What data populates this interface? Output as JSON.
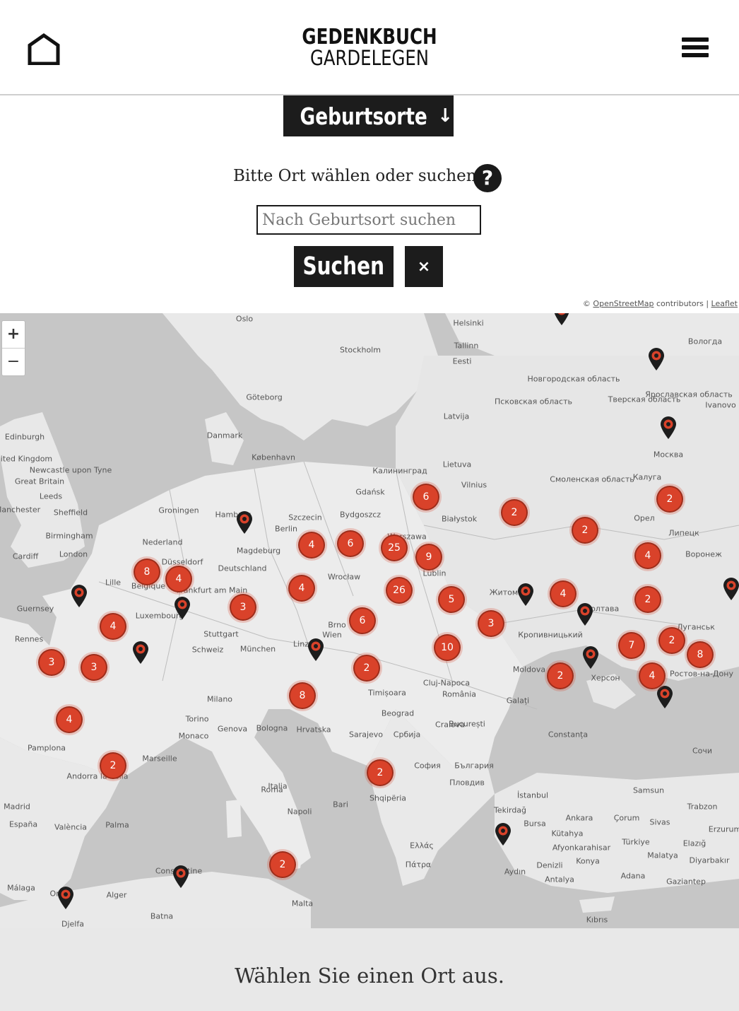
{
  "header": {
    "logo_line1": "GEDENKBUCH",
    "logo_line2": "GARDELEGEN",
    "home_icon": "home-icon",
    "menu_icon": "hamburger-menu-icon"
  },
  "filter": {
    "dropdown_label": "Geburtsorte",
    "dropdown_icon": "arrow-down-icon"
  },
  "instruction": "Bitte Ort wählen oder suchen.",
  "help_glyph": "?",
  "search": {
    "placeholder": "Nach Geburtsort suchen",
    "value": "",
    "button_label": "Suchen",
    "clear_label": "×"
  },
  "attribution": {
    "copyright": "©",
    "osm": "OpenStreetMap",
    "contributors": " contributors | ",
    "leaflet": "Leaflet"
  },
  "map": {
    "zoom_in": "+",
    "zoom_out": "−",
    "cluster_color": "#d9422a",
    "labels": [
      "Oslo",
      "Helsinki",
      "Stockholm",
      "Tallinn",
      "Eesti",
      "Göteborg",
      "Danmark",
      "København",
      "Latvija",
      "Lietuva",
      "Vilnius",
      "Edinburgh",
      "United Kingdom",
      "Great Britain",
      "Newcastle upon Tyne",
      "Leeds",
      "Manchester",
      "Sheffield",
      "Birmingham",
      "London",
      "Cardiff",
      "Groningen",
      "Hamburg",
      "Nederland",
      "Berlin",
      "Szczecin",
      "Bydgoszcz",
      "Gdańsk",
      "Калининград",
      "Białystok",
      "Москва",
      "Калуга",
      "Орел",
      "Воронеж",
      "Липецк",
      "Düsseldorf",
      "Deutschland",
      "Lille",
      "Belgique",
      "Magdeburg",
      "Frankfurt am Main",
      "Wrocław",
      "Warszawa",
      "Lublin",
      "Luxembourg",
      "Guernsey",
      "Rennes",
      "Stuttgart",
      "München",
      "Brno",
      "Wien",
      "Linz",
      "Житомир",
      "Полтава",
      "Кропивницький",
      "Херсон",
      "Ростов-на-Дону",
      "Луганськ",
      "Schweiz",
      "Milano",
      "Torino",
      "Genova",
      "Bologna",
      "Hrvatska",
      "Beograd",
      "România",
      "Cluj-Napoca",
      "Timișoara",
      "Craiova",
      "București",
      "Galați",
      "Constanța",
      "Moldova",
      "Marseille",
      "Monaco",
      "Pamplona",
      "Andorra la Vella",
      "España",
      "Madrid",
      "València",
      "Palma",
      "Italia",
      "Roma",
      "Napoli",
      "Bari",
      "Sarajevo",
      "Србија",
      "Shqipëria",
      "София",
      "България",
      "Пловдив",
      "Ελλάς",
      "Πάτρα",
      "İstanbul",
      "Tekirdağ",
      "Bursa",
      "Ankara",
      "Çorum",
      "Sivas",
      "Türkiye",
      "Konya",
      "Antalya",
      "Adana",
      "Kıbrıs",
      "Malta",
      "Alger",
      "Oran",
      "Constantine",
      "Batna",
      "Djelfa",
      "Málaga",
      "Samsun",
      "Trabzon",
      "Erzurum",
      "Elazığ",
      "Malatya",
      "Diyarbakır",
      "Gaziantep",
      "Aydın",
      "Denizli",
      "Kütahya",
      "Afyonkarahisar",
      "Сочи",
      "Вологда",
      "Ярославская область",
      "Ivanovo",
      "Тверская область",
      "Смоленская область",
      "Новгородская область",
      "Псковская область"
    ],
    "clusters": [
      "6",
      "2",
      "2",
      "2",
      "4",
      "6",
      "25",
      "9",
      "4",
      "8",
      "4",
      "4",
      "26",
      "5",
      "3",
      "4",
      "2",
      "4",
      "6",
      "3",
      "10",
      "7",
      "2",
      "8",
      "3",
      "3",
      "2",
      "2",
      "4",
      "8",
      "4",
      "2",
      "2",
      "2"
    ],
    "pins": [
      "location-pin-icon",
      "location-pin-icon",
      "location-pin-icon",
      "location-pin-icon",
      "location-pin-icon",
      "location-pin-icon",
      "location-pin-icon",
      "location-pin-icon",
      "location-pin-icon",
      "location-pin-icon",
      "location-pin-icon",
      "location-pin-icon",
      "location-pin-icon",
      "location-pin-icon",
      "location-pin-icon",
      "location-pin-icon"
    ]
  },
  "footer": {
    "text": "Wählen Sie einen Ort aus."
  }
}
